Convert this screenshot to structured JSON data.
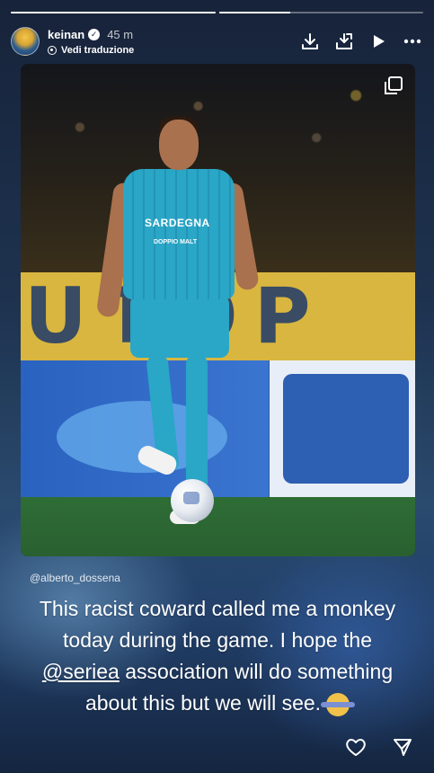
{
  "progress": {
    "segments": 2,
    "current_fill": 0.35
  },
  "header": {
    "username": "keinan",
    "time": "45 m",
    "translate_label": "Vedi traduzione",
    "actions": [
      "download-icon",
      "add-to-story-icon",
      "play-icon",
      "more-icon"
    ]
  },
  "post": {
    "mention": "@alberto_dossena",
    "caption_lines": [
      "This racist coward called me a monkey",
      "today during the game. I hope the",
      "association will do something",
      "about this but we will see."
    ],
    "tag": "@seriea",
    "jersey_sponsor": "SARDEGNA",
    "jersey_sponsor2": "DOPPIO MALT",
    "stadium_banner": "UTOP"
  },
  "footer": {
    "like_icon": "heart-icon",
    "share_icon": "send-icon"
  },
  "colors": {
    "accent": "#ffffff",
    "background": "#1e3350"
  }
}
